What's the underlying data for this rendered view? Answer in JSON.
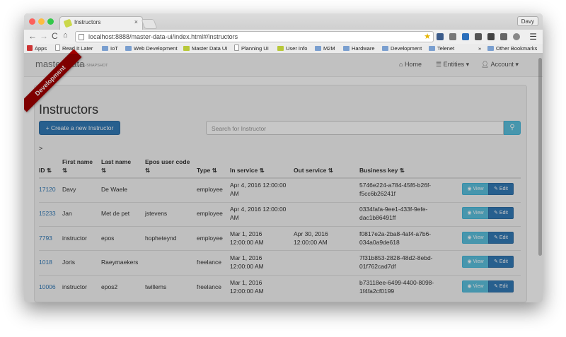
{
  "browser": {
    "tab_title": "Instructors",
    "tab_close": "×",
    "user_name": "Davy",
    "url": "localhost:8888/master-data-ui/index.html#/instructors"
  },
  "bookmarks": [
    {
      "label": "Apps",
      "icon": "apps-grid-icon"
    },
    {
      "label": "Read It Later",
      "icon": "page-icon"
    },
    {
      "label": "IoT",
      "icon": "folder-icon"
    },
    {
      "label": "Web Development",
      "icon": "folder-icon"
    },
    {
      "label": "Master Data UI",
      "icon": "master-data-icon"
    },
    {
      "label": "Planning UI",
      "icon": "page-icon"
    },
    {
      "label": "User Info",
      "icon": "user-info-icon"
    },
    {
      "label": "M2M",
      "icon": "folder-icon"
    },
    {
      "label": "Hardware",
      "icon": "folder-icon"
    },
    {
      "label": "Development",
      "icon": "folder-icon"
    },
    {
      "label": "Telenet",
      "icon": "folder-icon"
    },
    {
      "label": "»",
      "icon": ""
    },
    {
      "label": "Other Bookmarks",
      "icon": "folder-icon"
    }
  ],
  "navbar": {
    "brand": "master-data",
    "version": "v0.1-SNAPSHOT",
    "home": "Home",
    "entities": "Entities",
    "account": "Account"
  },
  "ribbon": "Development",
  "page": {
    "title": "Instructors",
    "create_button": "Create a new Instructor",
    "search_placeholder": "Search for Instructor",
    "breadcrumb": ">"
  },
  "table": {
    "headers": [
      "ID",
      "First name",
      "Last name",
      "Epos user code",
      "Type",
      "In service",
      "Out service",
      "Business key"
    ],
    "view_label": "View",
    "edit_label": "Edit",
    "rows": [
      {
        "id": "17120",
        "first": "Davy",
        "last": "De Waele",
        "epos": "",
        "type": "employee",
        "in1": "Apr 4, 2016 12:00:00",
        "in2": "AM",
        "out1": "",
        "out2": "",
        "key1": "5746e224-a784-45f6-b26f-",
        "key2": "f5cc6b26241f"
      },
      {
        "id": "15233",
        "first": "Jan",
        "last": "Met de pet",
        "epos": "jstevens",
        "type": "employee",
        "in1": "Apr 4, 2016 12:00:00",
        "in2": "AM",
        "out1": "",
        "out2": "",
        "key1": "0334fafa-9ee1-433f-9efe-",
        "key2": "dac1b86491ff"
      },
      {
        "id": "7793",
        "first": "instructor",
        "last": "epos",
        "epos": "hopheteynd",
        "type": "employee",
        "in1": "Mar 1, 2016",
        "in2": "12:00:00 AM",
        "out1": "Apr 30, 2016",
        "out2": "12:00:00 AM",
        "key1": "f0817e2a-2ba8-4af4-a7b6-",
        "key2": "034a0a9de618"
      },
      {
        "id": "1018",
        "first": "Joris",
        "last": "Raeymaekers",
        "epos": "",
        "type": "freelance",
        "in1": "Mar 1, 2016",
        "in2": "12:00:00 AM",
        "out1": "",
        "out2": "",
        "key1": "7f31b853-2828-48d2-8ebd-",
        "key2": "01f762cad7df"
      },
      {
        "id": "10006",
        "first": "instructor",
        "last": "epos2",
        "epos": "twillems",
        "type": "freelance",
        "in1": "Mar 1, 2016",
        "in2": "12:00:00 AM",
        "out1": "",
        "out2": "",
        "key1": "b73118ee-6499-4400-8098-",
        "key2": "1f4fa2cf0199"
      }
    ]
  },
  "colors": {
    "primary": "#337ab7",
    "info": "#5bc0de",
    "ribbon": "#a30000"
  }
}
